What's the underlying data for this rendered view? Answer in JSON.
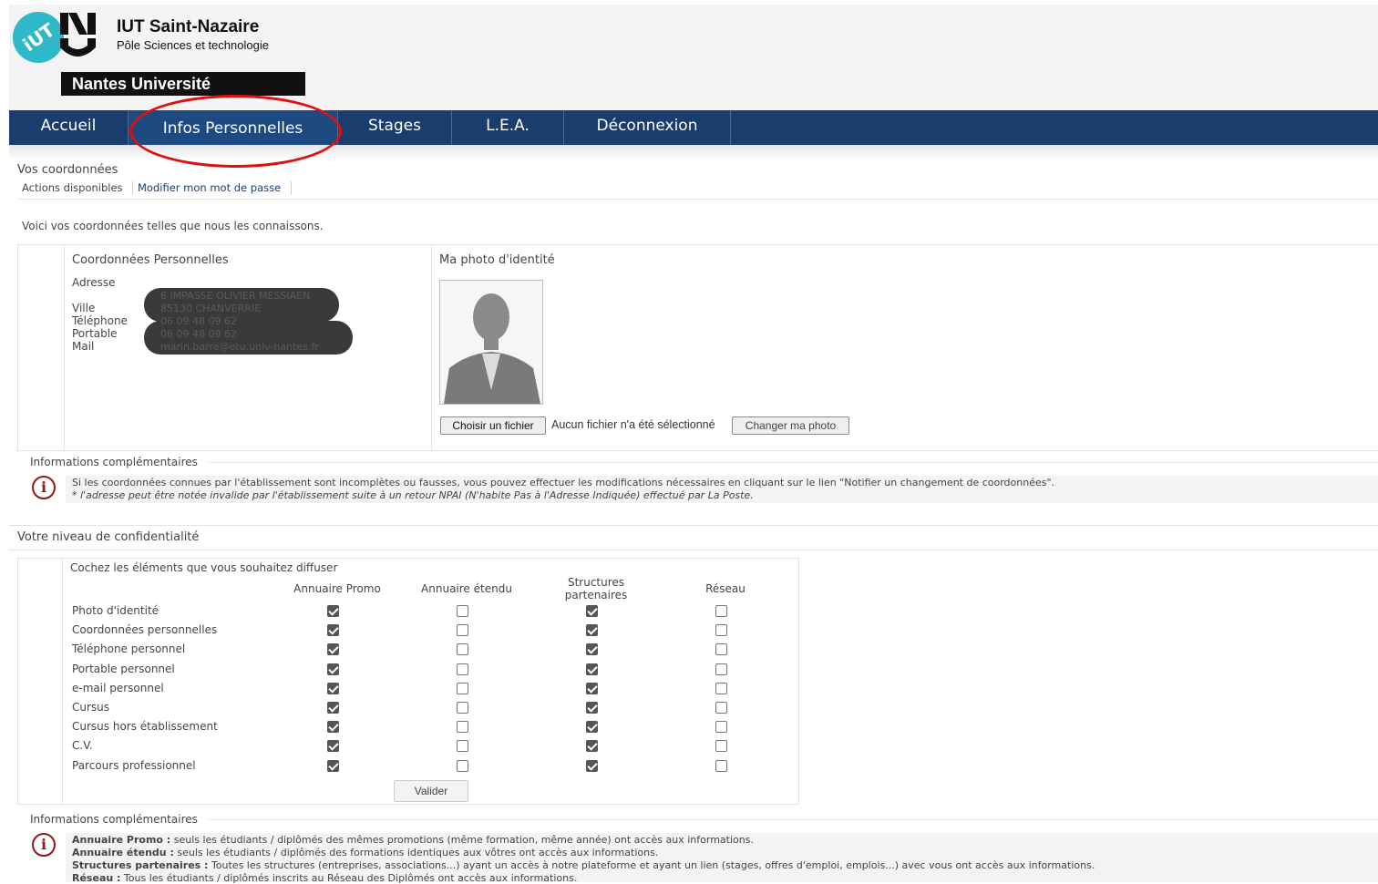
{
  "header": {
    "title": "IUT Saint-Nazaire",
    "subtitle": "Pôle Sciences et technologie",
    "university": "Nantes Université"
  },
  "nav": [
    {
      "label": "Accueil"
    },
    {
      "label": "Infos Personnelles"
    },
    {
      "label": "Stages"
    },
    {
      "label": "L.E.A."
    },
    {
      "label": "Déconnexion"
    }
  ],
  "coords_section": {
    "title": "Vos coordonnées",
    "actions_label": "Actions disponibles",
    "action_link": "Modifier mon mot de passe",
    "intro": "Voici vos coordonnées telles que nous les connaissons."
  },
  "personal": {
    "heading": "Coordonnées Personnelles",
    "labels": [
      "Adresse",
      "Ville",
      "Téléphone",
      "Portable",
      "Mail"
    ],
    "values": {
      "address": "6 IMPASSE OLIVIER MESSIAEN",
      "city": "85130 CHANVERRIE",
      "phone": "06 09 48 09 62",
      "mobile": "06 09 48 09 62",
      "mail": "marin.barre@etu.univ-nantes.fr"
    }
  },
  "photo": {
    "heading": "Ma photo d'identité",
    "choose_button": "Choisir un fichier",
    "no_file": "Aucun fichier n'a été sélectionné",
    "change_button": "Changer ma photo"
  },
  "info1": {
    "legend": "Informations complémentaires",
    "line1": "Si les coordonnées connues par l'établissement sont incomplètes ou fausses, vous pouvez effectuer les modifications nécessaires en cliquant sur le lien \"Notifier un changement de coordonnées\".",
    "line2": "* l'adresse peut être notée invalide par l'établissement suite à un retour NPAI (N'habite Pas à l'Adresse Indiquée) effectué par La Poste."
  },
  "privacy": {
    "title": "Votre niveau de confidentialité",
    "instruction": "Cochez les éléments que vous souhaitez diffuser",
    "columns": [
      "Annuaire Promo",
      "Annuaire étendu",
      "Structures partenaires",
      "Réseau"
    ],
    "rows": [
      {
        "label": "Photo d'identité",
        "checks": [
          true,
          false,
          true,
          false
        ]
      },
      {
        "label": "Coordonnées personnelles",
        "checks": [
          true,
          false,
          true,
          false
        ]
      },
      {
        "label": "Téléphone personnel",
        "checks": [
          true,
          false,
          true,
          false
        ]
      },
      {
        "label": "Portable personnel",
        "checks": [
          true,
          false,
          true,
          false
        ]
      },
      {
        "label": "e-mail personnel",
        "checks": [
          true,
          false,
          true,
          false
        ]
      },
      {
        "label": "Cursus",
        "checks": [
          true,
          false,
          true,
          false
        ]
      },
      {
        "label": "Cursus hors établissement",
        "checks": [
          true,
          false,
          true,
          false
        ]
      },
      {
        "label": "C.V.",
        "checks": [
          true,
          false,
          true,
          false
        ]
      },
      {
        "label": "Parcours professionnel",
        "checks": [
          true,
          false,
          true,
          false
        ]
      }
    ],
    "submit": "Valider"
  },
  "info2": {
    "legend": "Informations complémentaires",
    "items": [
      {
        "term": "Annuaire Promo :",
        "text": "seuls les étudiants / diplômés des mêmes promotions (même formation, même année) ont accès aux informations."
      },
      {
        "term": "Annuaire étendu :",
        "text": "seuls les étudiants / diplômés des formations identiques aux vôtres ont accès aux informations."
      },
      {
        "term": "Structures partenaires :",
        "text": "Toutes les structures (entreprises, associations...) ayant un accès à notre plateforme et ayant un lien (stages, offres d'emploi, emplois...) avec vous ont accès aux informations."
      },
      {
        "term": "Réseau :",
        "text": "Tous les étudiants / diplômés inscrits au Réseau des Diplômés ont accès aux informations."
      }
    ]
  }
}
